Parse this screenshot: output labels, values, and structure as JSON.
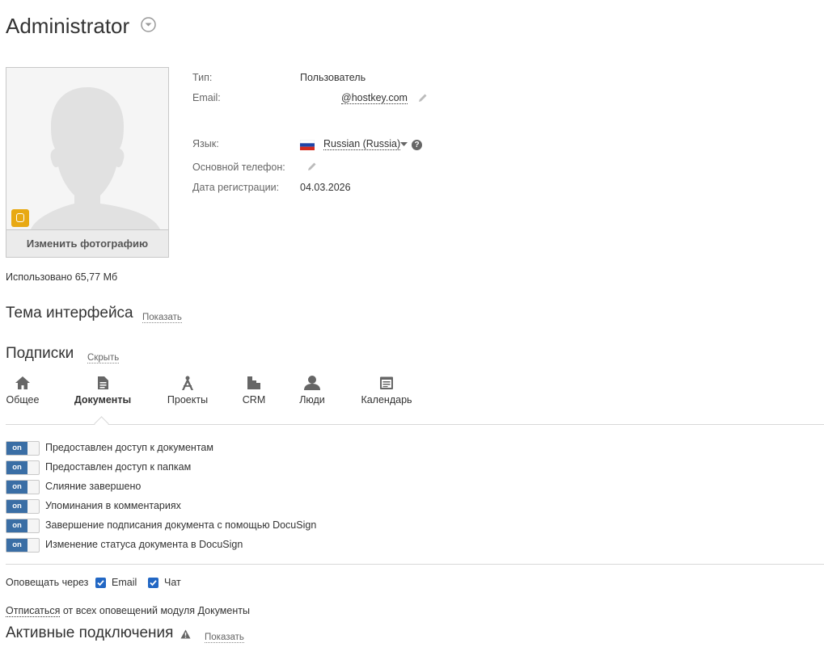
{
  "header": {
    "title": "Administrator"
  },
  "profile": {
    "change_photo_label": "Изменить фотографию",
    "fields": {
      "type_label": "Тип:",
      "type_value": "Пользователь",
      "email_label": "Email:",
      "email_value": "@hostkey.com",
      "language_label": "Язык:",
      "language_value": "Russian (Russia)",
      "phone_label": "Основной телефон:",
      "registration_label": "Дата регистрации:",
      "registration_value": "04.03.2026"
    },
    "quota_text": "Использовано 65,77 Мб"
  },
  "theme": {
    "title": "Тема интерфейса",
    "link": "Показать"
  },
  "subscriptions": {
    "title": "Подписки",
    "link": "Скрыть",
    "tabs": [
      {
        "label": "Общее"
      },
      {
        "label": "Документы"
      },
      {
        "label": "Проекты"
      },
      {
        "label": "CRM"
      },
      {
        "label": "Люди"
      },
      {
        "label": "Календарь"
      }
    ],
    "toggle_on_label": "on",
    "toggles": [
      {
        "label": "Предоставлен доступ к документам"
      },
      {
        "label": "Предоставлен доступ к папкам"
      },
      {
        "label": "Слияние завершено"
      },
      {
        "label": "Упоминания в комментариях"
      },
      {
        "label": "Завершение подписания документа с помощью DocuSign"
      },
      {
        "label": "Изменение статуса документа в DocuSign"
      }
    ],
    "notify_label": "Оповещать через",
    "notify_email": "Email",
    "notify_chat": "Чат",
    "unsubscribe_link": "Отписаться",
    "unsubscribe_rest": " от всех оповещений модуля Документы"
  },
  "connections": {
    "title": "Активные подключения",
    "link": "Показать"
  },
  "colors": {
    "accent": "#3a6ea5",
    "checkbox": "#2267c4",
    "status_badge": "#e8a913"
  }
}
